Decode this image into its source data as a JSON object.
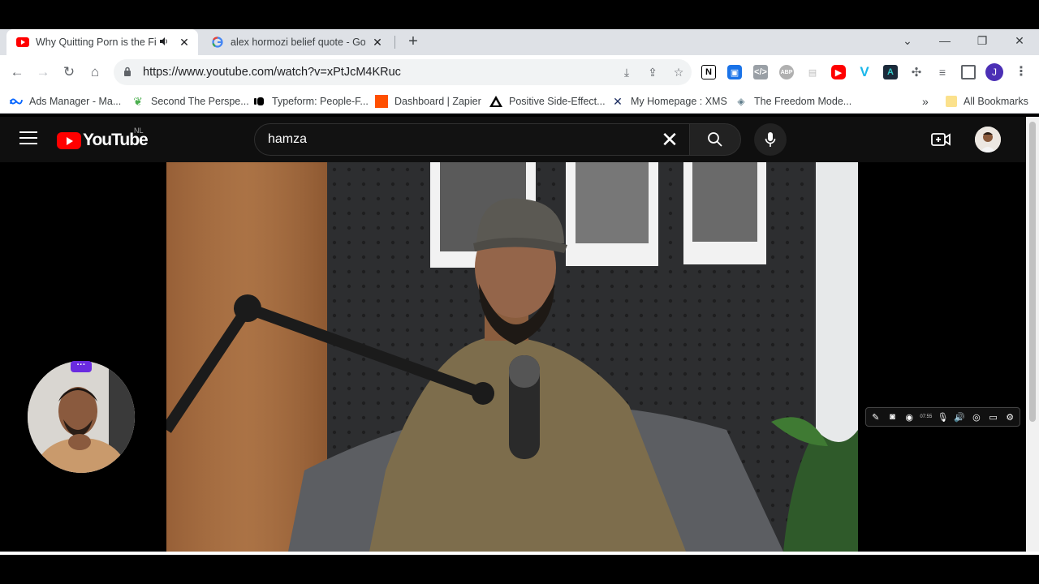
{
  "browser": {
    "tabs": [
      {
        "title": "Why Quitting Porn is the First",
        "active": true,
        "favicon": "youtube-icon",
        "muted": true
      },
      {
        "title": "alex hormozi belief quote - Google",
        "active": false,
        "favicon": "google-icon"
      }
    ],
    "close_glyph": "✕",
    "new_tab_glyph": "+",
    "url": "https://www.youtube.com/watch?v=xPtJcM4KRuc",
    "profile_initial": "J",
    "bookmarks": [
      {
        "label": "Ads Manager - Ma...",
        "icon": "meta-icon",
        "color": "#0866ff"
      },
      {
        "label": "Second The Perspe...",
        "icon": "leaf-icon",
        "color": "#4caf50"
      },
      {
        "label": "Typeform: People-F...",
        "icon": "typeform-icon",
        "color": "#000000"
      },
      {
        "label": "Dashboard | Zapier",
        "icon": "zapier-icon",
        "color": "#ff4f00"
      },
      {
        "label": "Positive Side-Effect...",
        "icon": "triangle-icon",
        "color": "#000000"
      },
      {
        "label": "My Homepage : XMS",
        "icon": "x-icon",
        "color": "#1a2b5f"
      },
      {
        "label": "The Freedom Mode...",
        "icon": "diamond-icon",
        "color": "#607d8b"
      }
    ],
    "overflow_glyph": "»",
    "all_bookmarks": "All Bookmarks"
  },
  "youtube": {
    "logo_text": "YouTube",
    "country_code": "NL",
    "search_query": "hamza"
  },
  "colors": {
    "youtube_red": "#ff0000",
    "masthead_bg": "#0f0f0f",
    "accent_purple": "#6a2be0"
  },
  "recorder": {
    "time": "07:55"
  }
}
